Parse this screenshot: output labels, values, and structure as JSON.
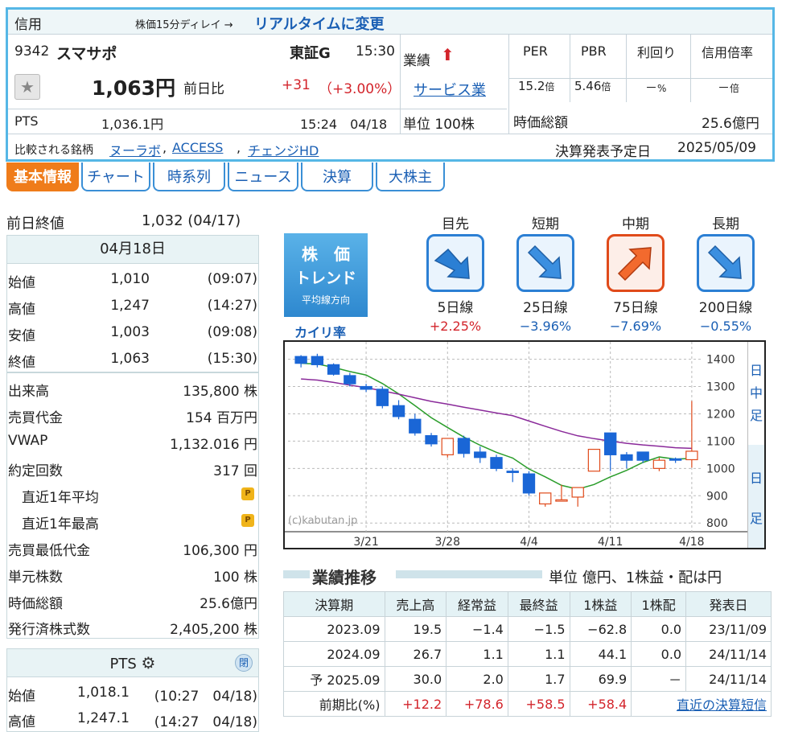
{
  "header": {
    "market_type": "信用",
    "delay_note": "株価15分ディレイ →",
    "realtime_link": "リアルタイムに変更",
    "code": "9342",
    "name": "スマサポ",
    "exchange": "東証G",
    "time": "15:30",
    "price": "1,063円",
    "change_label": "前日比",
    "change": "+31",
    "change_pct": "（+3.00%）",
    "pts_label": "PTS",
    "pts_price": "1,036.1円",
    "pts_time": "15:24　04/18",
    "gyoseki_label": "業績",
    "sector": "サービス業",
    "unit": "単位 100株",
    "indicators": [
      {
        "label": "PER",
        "value": "15.2",
        "unit": "倍"
      },
      {
        "label": "PBR",
        "value": "5.46",
        "unit": "倍"
      },
      {
        "label": "利回り",
        "value": "－",
        "unit": "%"
      },
      {
        "label": "信用倍率",
        "value": "－",
        "unit": "倍"
      }
    ],
    "market_cap_label": "時価総額",
    "market_cap": "25.6億円",
    "compare_label": "比較される銘柄",
    "compare": [
      "ヌーラボ",
      "ACCESS",
      "チェンジHD"
    ],
    "earnings_date_label": "決算発表予定日",
    "earnings_date": "2025/05/09"
  },
  "tabs": [
    "基本情報",
    "チャート",
    "時系列",
    "ニュース",
    "決算",
    "大株主"
  ],
  "left": {
    "prev_close_label": "前日終値",
    "prev_close": "1,032 (04/17)",
    "date": "04月18日",
    "ohlc": [
      {
        "k": "始値",
        "v": "1,010",
        "t": "(09:07)"
      },
      {
        "k": "高値",
        "v": "1,247",
        "t": "(14:27)"
      },
      {
        "k": "安値",
        "v": "1,003",
        "t": "(09:08)"
      },
      {
        "k": "終値",
        "v": "1,063",
        "t": "(15:30)"
      }
    ],
    "stats": [
      {
        "k": "出来高",
        "v": "135,800 株"
      },
      {
        "k": "売買代金",
        "v": "154 百万円"
      },
      {
        "k": "VWAP",
        "v": "1,132.016 円"
      },
      {
        "k": "約定回数",
        "v": "317 回"
      },
      {
        "k": "　直近1年平均",
        "v": ""
      },
      {
        "k": "　直近1年最高",
        "v": ""
      },
      {
        "k": "売買最低代金",
        "v": "106,300 円"
      },
      {
        "k": "単元株数",
        "v": "100 株"
      },
      {
        "k": "時価総額",
        "v": "25.6億円"
      },
      {
        "k": "発行済株式数",
        "v": "2,405,200 株"
      }
    ],
    "pts_title": "PTS",
    "pts_close": "閉",
    "pts_rows": [
      {
        "k": "始値",
        "v": "1,018.1",
        "t": "(10:27　04/18)"
      },
      {
        "k": "高値",
        "v": "1,247.1",
        "t": "(14:27　04/18)"
      }
    ]
  },
  "trend": {
    "logo_line1": "株　価",
    "logo_line2": "トレンド",
    "logo_line3": "平均線方向",
    "kairi_label": "カイリ率",
    "items": [
      {
        "period": "目先",
        "ma": "5日線",
        "rate": "+2.25%",
        "dir": "down"
      },
      {
        "period": "短期",
        "ma": "25日線",
        "rate": "−3.96%",
        "dir": "down"
      },
      {
        "period": "中期",
        "ma": "75日線",
        "rate": "−7.69%",
        "dir": "up"
      },
      {
        "period": "長期",
        "ma": "200日線",
        "rate": "−0.55%",
        "dir": "down"
      }
    ]
  },
  "chart": {
    "watermark": "(c)kabutan.jp",
    "y_ticks": [
      "1400",
      "1300",
      "1200",
      "1100",
      "1000",
      "900",
      "800"
    ],
    "x_ticks": [
      "3/21",
      "3/28",
      "4/4",
      "4/11",
      "4/18"
    ],
    "side_tabs": [
      "日",
      "中",
      "足",
      "日",
      "足"
    ]
  },
  "chart_data": {
    "type": "candlestick",
    "y_range": [
      780,
      1440
    ],
    "candles": [
      {
        "o": 1410,
        "h": 1415,
        "l": 1370,
        "c": 1385
      },
      {
        "o": 1410,
        "h": 1420,
        "l": 1370,
        "c": 1380
      },
      {
        "o": 1380,
        "h": 1385,
        "l": 1340,
        "c": 1345
      },
      {
        "o": 1340,
        "h": 1350,
        "l": 1300,
        "c": 1310
      },
      {
        "o": 1300,
        "h": 1310,
        "l": 1280,
        "c": 1290
      },
      {
        "o": 1290,
        "h": 1300,
        "l": 1220,
        "c": 1230
      },
      {
        "o": 1230,
        "h": 1250,
        "l": 1180,
        "c": 1190
      },
      {
        "o": 1180,
        "h": 1200,
        "l": 1120,
        "c": 1130
      },
      {
        "o": 1120,
        "h": 1130,
        "l": 1080,
        "c": 1090
      },
      {
        "o": 1050,
        "h": 1110,
        "l": 1040,
        "c": 1110
      },
      {
        "o": 1110,
        "h": 1120,
        "l": 1040,
        "c": 1055
      },
      {
        "o": 1060,
        "h": 1080,
        "l": 1020,
        "c": 1040
      },
      {
        "o": 1040,
        "h": 1050,
        "l": 990,
        "c": 1000
      },
      {
        "o": 990,
        "h": 1000,
        "l": 950,
        "c": 985
      },
      {
        "o": 980,
        "h": 990,
        "l": 900,
        "c": 910
      },
      {
        "o": 870,
        "h": 910,
        "l": 860,
        "c": 910
      },
      {
        "o": 880,
        "h": 940,
        "l": 880,
        "c": 885
      },
      {
        "o": 895,
        "h": 925,
        "l": 860,
        "c": 930
      },
      {
        "o": 990,
        "h": 1070,
        "l": 990,
        "c": 1070
      },
      {
        "o": 1130,
        "h": 1130,
        "l": 990,
        "c": 1050
      },
      {
        "o": 1050,
        "h": 1060,
        "l": 1000,
        "c": 1030
      },
      {
        "o": 1060,
        "h": 1060,
        "l": 1020,
        "c": 1030
      },
      {
        "o": 1000,
        "h": 1040,
        "l": 990,
        "c": 1030
      },
      {
        "o": 1035,
        "h": 1040,
        "l": 1020,
        "c": 1030
      },
      {
        "o": 1032,
        "h": 1247,
        "l": 1003,
        "c": 1063
      }
    ]
  },
  "financials": {
    "title": "業績推移",
    "unit_note": "単位 億円、1株益・配は円",
    "headers": [
      "決算期",
      "売上高",
      "経常益",
      "最終益",
      "1株益",
      "1株配",
      "発表日"
    ],
    "rows": [
      [
        "2023.09",
        "19.5",
        "−1.4",
        "−1.5",
        "−62.8",
        "0.0",
        "23/11/09"
      ],
      [
        "2024.09",
        "26.7",
        "1.1",
        "1.1",
        "44.1",
        "0.0",
        "24/11/14"
      ],
      [
        "予 2025.09",
        "30.0",
        "2.0",
        "1.7",
        "69.9",
        "－",
        "24/11/14"
      ]
    ],
    "compare_label": "前期比(%)",
    "compare": [
      "+12.2",
      "+78.6",
      "+58.5",
      "+58.4"
    ],
    "link": "直近の決算短信"
  }
}
